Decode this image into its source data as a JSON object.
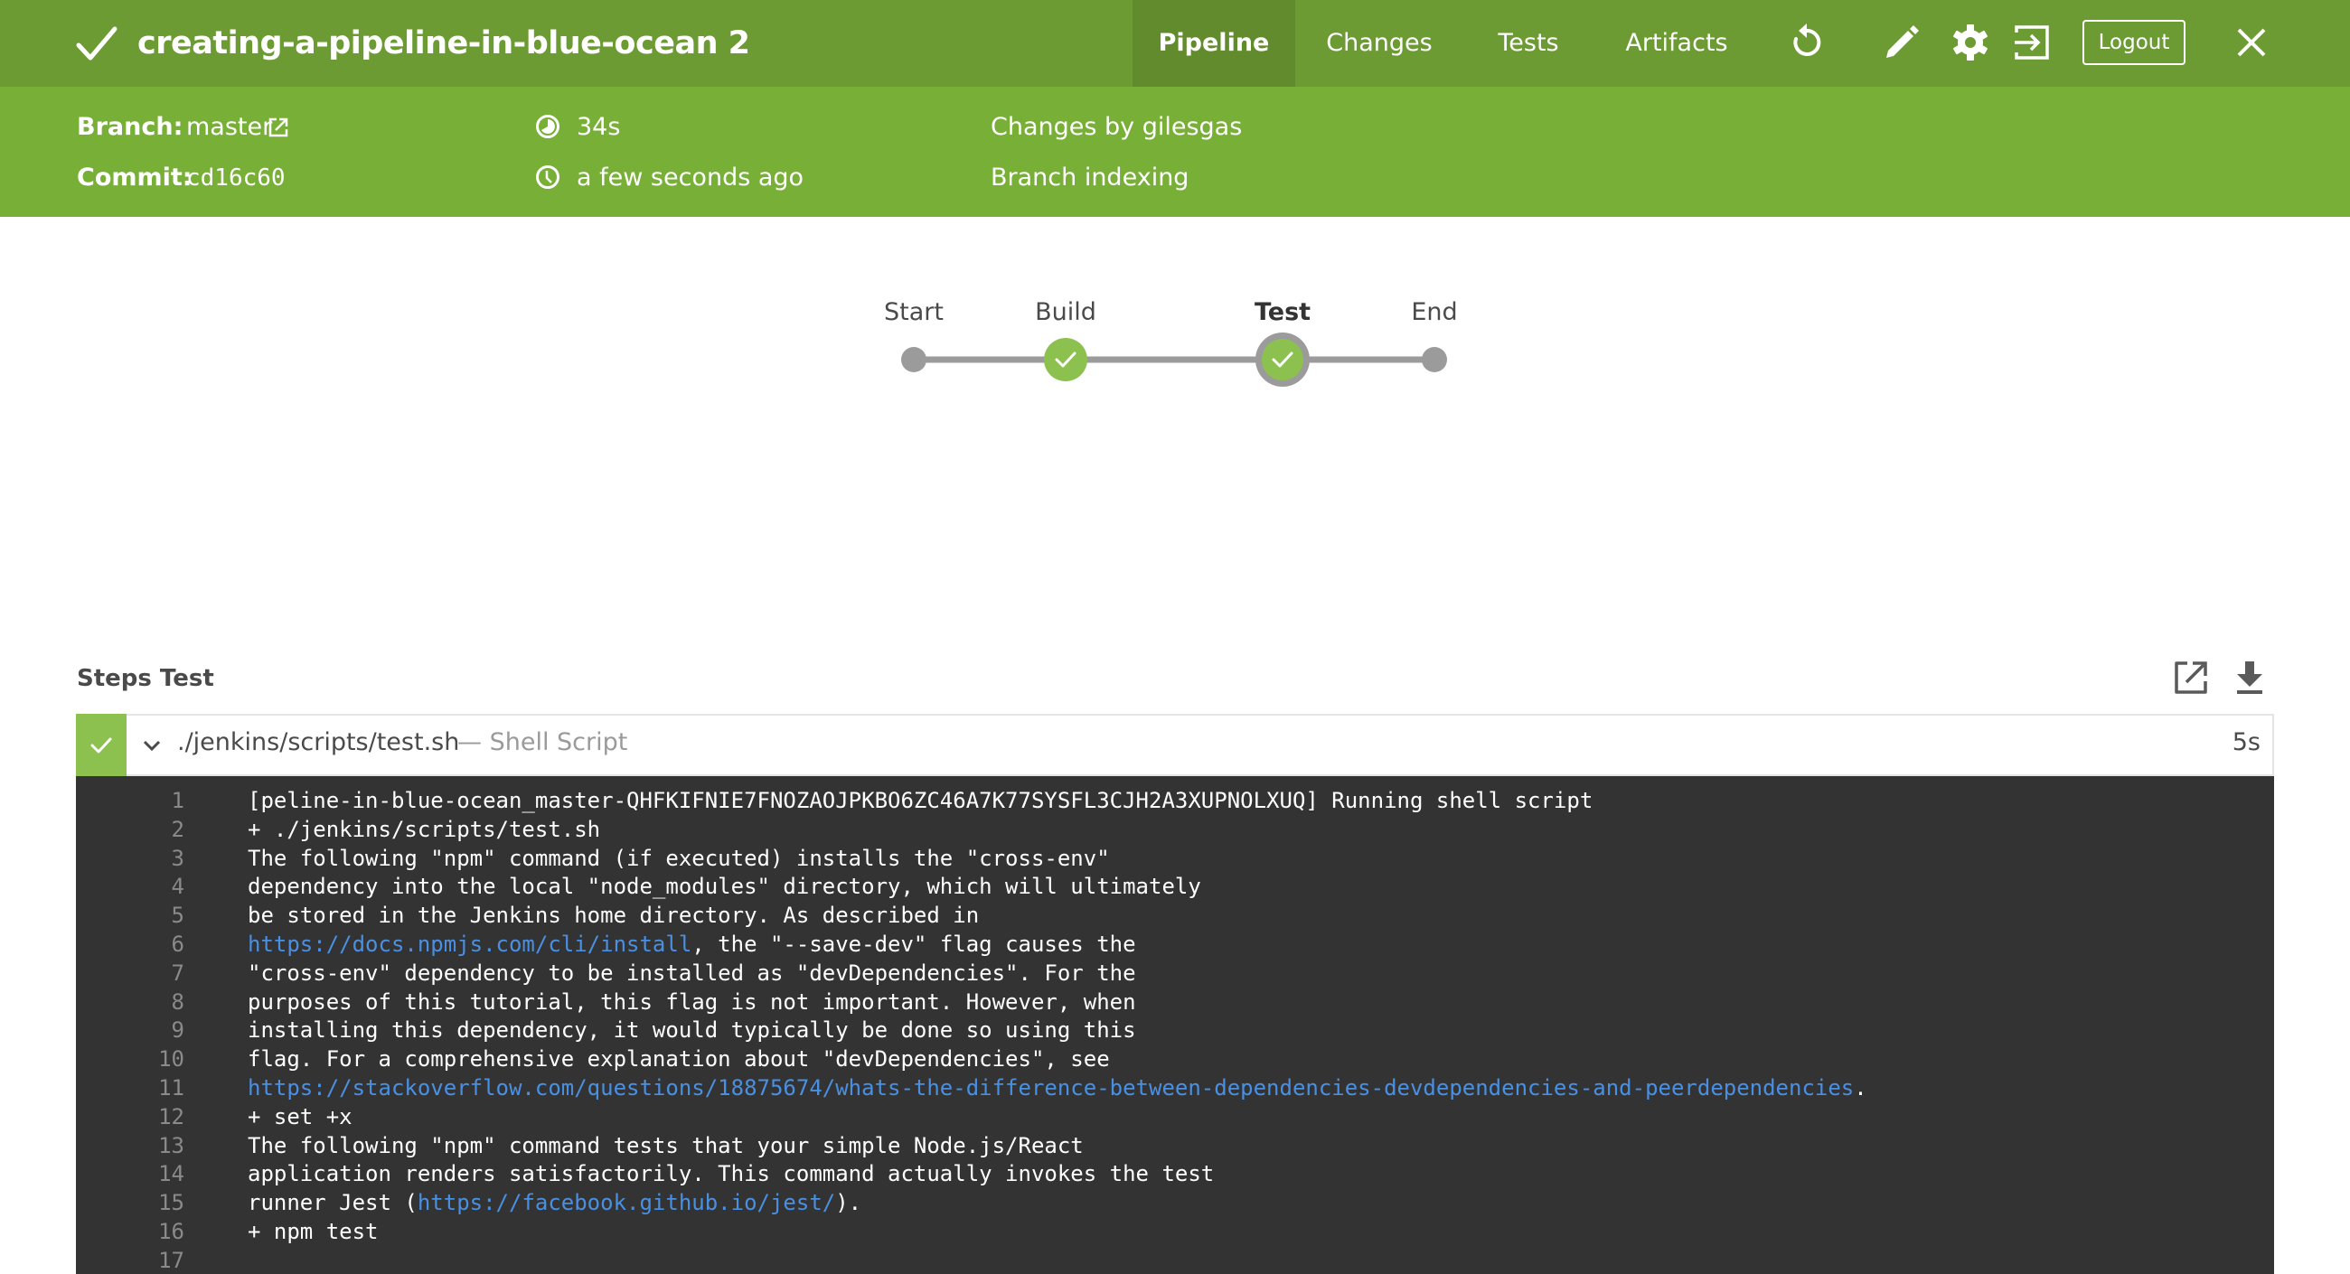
{
  "header": {
    "title": "creating-a-pipeline-in-blue-ocean 2",
    "status": "success",
    "tabs": [
      {
        "label": "Pipeline",
        "active": true
      },
      {
        "label": "Changes",
        "active": false
      },
      {
        "label": "Tests",
        "active": false
      },
      {
        "label": "Artifacts",
        "active": false
      }
    ],
    "icons": [
      "replay-icon",
      "edit-icon",
      "settings-icon",
      "login-icon",
      "close-icon"
    ],
    "logout_label": "Logout"
  },
  "run_meta": {
    "branch_label": "Branch:",
    "branch_value": "master",
    "commit_label": "Commit:",
    "commit_value": "cd16c60",
    "duration": "34s",
    "started": "a few seconds ago",
    "changes": "Changes by gilesgas",
    "cause": "Branch indexing"
  },
  "pipeline_graph": {
    "stages": [
      {
        "label": "Start",
        "type": "terminal",
        "selected": false
      },
      {
        "label": "Build",
        "type": "stage",
        "status": "success",
        "selected": false
      },
      {
        "label": "Test",
        "type": "stage",
        "status": "success",
        "selected": true
      },
      {
        "label": "End",
        "type": "terminal",
        "selected": false
      }
    ]
  },
  "steps": {
    "title": "Steps Test",
    "items": [
      {
        "name": "./jenkins/scripts/test.sh",
        "type": "— Shell Script",
        "duration": "5s",
        "status": "success",
        "expanded": true
      }
    ]
  },
  "log": {
    "lines": [
      {
        "n": "1",
        "parts": [
          {
            "t": "[peline-in-blue-ocean_master-QHFKIFNIE7FNOZAOJPKBO6ZC46A7K77SYSFL3CJH2A3XUPNOLXUQ] Running shell script"
          }
        ]
      },
      {
        "n": "2",
        "parts": [
          {
            "t": "+ ./jenkins/scripts/test.sh"
          }
        ]
      },
      {
        "n": "3",
        "parts": [
          {
            "t": "The following \"npm\" command (if executed) installs the \"cross-env\""
          }
        ]
      },
      {
        "n": "4",
        "parts": [
          {
            "t": "dependency into the local \"node_modules\" directory, which will ultimately"
          }
        ]
      },
      {
        "n": "5",
        "parts": [
          {
            "t": "be stored in the Jenkins home directory. As described in"
          }
        ]
      },
      {
        "n": "6",
        "parts": [
          {
            "t": "https://docs.npmjs.com/cli/install",
            "link": true
          },
          {
            "t": ", the \"--save-dev\" flag causes the"
          }
        ]
      },
      {
        "n": "7",
        "parts": [
          {
            "t": "\"cross-env\" dependency to be installed as \"devDependencies\". For the"
          }
        ]
      },
      {
        "n": "8",
        "parts": [
          {
            "t": "purposes of this tutorial, this flag is not important. However, when"
          }
        ]
      },
      {
        "n": "9",
        "parts": [
          {
            "t": "installing this dependency, it would typically be done so using this"
          }
        ]
      },
      {
        "n": "10",
        "parts": [
          {
            "t": "flag. For a comprehensive explanation about \"devDependencies\", see"
          }
        ]
      },
      {
        "n": "11",
        "parts": [
          {
            "t": "https://stackoverflow.com/questions/18875674/whats-the-difference-between-dependencies-devdependencies-and-peerdependencies",
            "link": true
          },
          {
            "t": "."
          }
        ]
      },
      {
        "n": "12",
        "parts": [
          {
            "t": "+ set +x"
          }
        ]
      },
      {
        "n": "13",
        "parts": [
          {
            "t": "The following \"npm\" command tests that your simple Node.js/React"
          }
        ]
      },
      {
        "n": "14",
        "parts": [
          {
            "t": "application renders satisfactorily. This command actually invokes the test"
          }
        ]
      },
      {
        "n": "15",
        "parts": [
          {
            "t": "runner Jest ("
          },
          {
            "t": "https://facebook.github.io/jest/",
            "link": true
          },
          {
            "t": ")."
          }
        ]
      },
      {
        "n": "16",
        "parts": [
          {
            "t": "+ npm test"
          }
        ]
      },
      {
        "n": "17",
        "parts": [
          {
            "t": ""
          }
        ]
      }
    ]
  },
  "colors": {
    "header_bg": "#6d9b33",
    "active_tab_bg": "#628b2d",
    "subheader_bg": "#78b037",
    "success_green": "#8cc04f",
    "graph_gray": "#9b9b9b",
    "log_bg": "#333333",
    "link_blue": "#4a90e2"
  }
}
